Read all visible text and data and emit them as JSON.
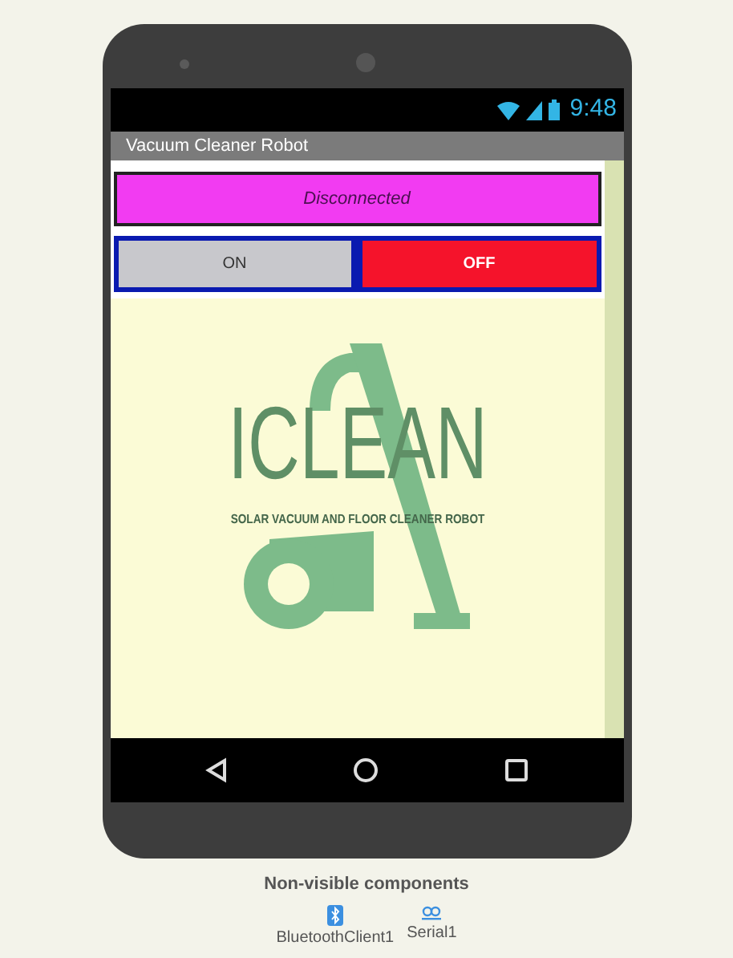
{
  "status_bar": {
    "time": "9:48"
  },
  "title_bar": {
    "title": "Vacuum Cleaner Robot"
  },
  "status_label": {
    "text": "Disconnected"
  },
  "buttons": [
    {
      "label": "ON",
      "color": "#c8c8cc"
    },
    {
      "label": "OFF",
      "color": "#f5132b"
    }
  ],
  "logo": {
    "title": "ICLEAN",
    "subtitle": "SOLAR VACUUM AND FLOOR CLEANER ROBOT"
  },
  "non_visible": {
    "heading": "Non-visible components",
    "components": [
      {
        "name": "BluetoothClient1",
        "kind": "bluetooth"
      },
      {
        "name": "Serial1",
        "kind": "serial"
      }
    ]
  }
}
